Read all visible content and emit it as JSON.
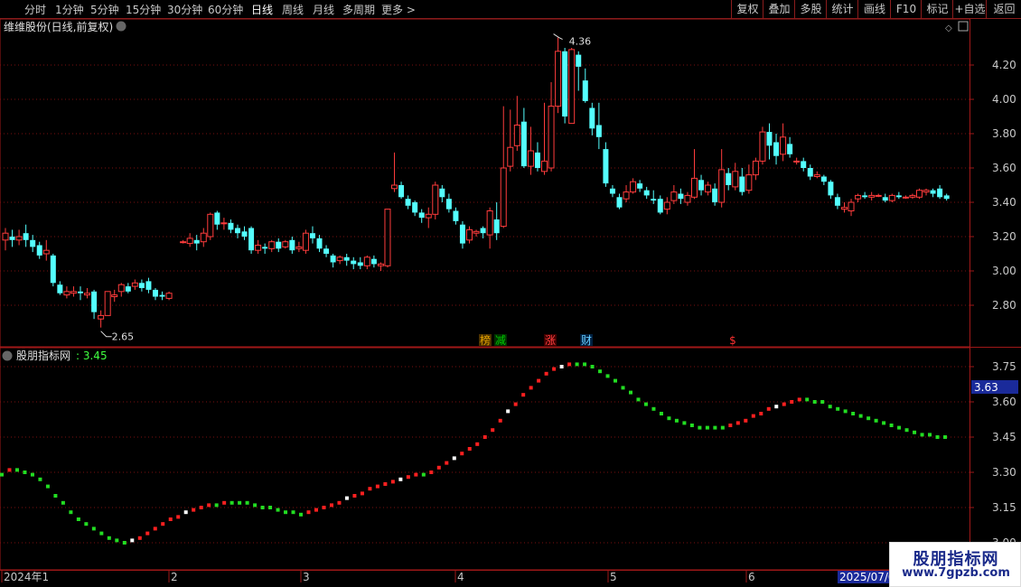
{
  "toolbar": {
    "periods": [
      "分时",
      "1分钟",
      "5分钟",
      "15分钟",
      "30分钟",
      "60分钟",
      "日线",
      "周线",
      "月线",
      "多周期",
      "更多 >"
    ],
    "active_period": "日线",
    "right_buttons": [
      "复权",
      "叠加",
      "多股",
      "统计",
      "画线",
      "F10",
      "标记",
      "+自选",
      "返回"
    ]
  },
  "main_panel": {
    "title": "维维股份(日线,前复权)",
    "high_label": "4.36",
    "low_label": "2.65",
    "event_marks": [
      {
        "text": "榜",
        "color": "#e0a000",
        "bg": "#4a3000"
      },
      {
        "text": "减",
        "color": "#00c800",
        "bg": "#003000"
      },
      {
        "text": "涨",
        "color": "#ff4040",
        "bg": "#400000"
      },
      {
        "text": "财",
        "color": "#66ccff",
        "bg": "#002040"
      },
      {
        "text": "$",
        "color": "#ff3030",
        "bg": ""
      }
    ],
    "y_ticks": [
      "4.20",
      "4.00",
      "3.80",
      "3.60",
      "3.40",
      "3.20",
      "3.00",
      "2.80"
    ]
  },
  "indicator_panel": {
    "name": "股朋指标网",
    "value": "3.45",
    "current_value_box": "3.63",
    "y_ticks": [
      "3.75",
      "3.60",
      "3.45",
      "3.30",
      "3.15",
      "3.00"
    ]
  },
  "x_axis": {
    "labels": [
      "2024年1",
      "2",
      "3",
      "4",
      "5",
      "6"
    ],
    "cursor_date": "2025/07/0"
  },
  "watermark": {
    "title": "股朋指标网",
    "url": "www.7gpzb.com"
  },
  "colors": {
    "up": "#ff3c3c",
    "down": "#54ffff",
    "indicator_up": "#ff2020",
    "indicator_down": "#22dd22",
    "indicator_flat": "#ffffff",
    "grid": "#7a1010",
    "frame": "#a01818"
  },
  "chart_data": [
    {
      "type": "candlestick",
      "title": "维维股份(日线,前复权)",
      "ylim": [
        2.62,
        4.38
      ],
      "candles": [
        [
          3.18,
          3.22,
          3.25,
          3.12
        ],
        [
          3.2,
          3.18,
          3.24,
          3.14
        ],
        [
          3.18,
          3.2,
          3.24,
          3.15
        ],
        [
          3.22,
          3.18,
          3.27,
          3.14
        ],
        [
          3.18,
          3.14,
          3.21,
          3.11
        ],
        [
          3.15,
          3.09,
          3.17,
          3.07
        ],
        [
          3.1,
          3.12,
          3.18,
          3.06
        ],
        [
          3.09,
          2.93,
          3.1,
          2.91
        ],
        [
          2.92,
          2.87,
          2.94,
          2.86
        ],
        [
          2.86,
          2.88,
          2.91,
          2.84
        ],
        [
          2.87,
          2.88,
          2.91,
          2.85
        ],
        [
          2.88,
          2.87,
          2.91,
          2.83
        ],
        [
          2.86,
          2.87,
          2.9,
          2.84
        ],
        [
          2.88,
          2.76,
          2.89,
          2.72
        ],
        [
          2.72,
          2.74,
          2.77,
          2.67
        ],
        [
          2.74,
          2.88,
          2.88,
          2.74
        ],
        [
          2.85,
          2.86,
          2.89,
          2.82
        ],
        [
          2.88,
          2.92,
          2.93,
          2.85
        ],
        [
          2.91,
          2.88,
          2.93,
          2.87
        ],
        [
          2.91,
          2.93,
          2.95,
          2.89
        ],
        [
          2.93,
          2.9,
          2.95,
          2.88
        ],
        [
          2.94,
          2.89,
          2.96,
          2.87
        ],
        [
          2.89,
          2.85,
          2.9,
          2.83
        ],
        [
          2.86,
          2.85,
          2.88,
          2.83
        ],
        [
          2.84,
          2.87,
          2.88,
          2.83
        ],
        [
          3.17,
          3.17,
          3.18,
          3.16
        ],
        [
          3.16,
          3.19,
          3.22,
          3.14
        ],
        [
          3.18,
          3.16,
          3.21,
          3.12
        ],
        [
          3.17,
          3.22,
          3.25,
          3.14
        ],
        [
          3.2,
          3.33,
          3.34,
          3.18
        ],
        [
          3.34,
          3.27,
          3.35,
          3.24
        ],
        [
          3.28,
          3.28,
          3.31,
          3.24
        ],
        [
          3.28,
          3.24,
          3.3,
          3.22
        ],
        [
          3.25,
          3.22,
          3.27,
          3.19
        ],
        [
          3.23,
          3.2,
          3.26,
          3.18
        ],
        [
          3.25,
          3.12,
          3.26,
          3.1
        ],
        [
          3.12,
          3.15,
          3.18,
          3.1
        ],
        [
          3.14,
          3.13,
          3.16,
          3.1
        ],
        [
          3.13,
          3.17,
          3.18,
          3.11
        ],
        [
          3.17,
          3.13,
          3.19,
          3.11
        ],
        [
          3.14,
          3.17,
          3.18,
          3.13
        ],
        [
          3.18,
          3.12,
          3.2,
          3.1
        ],
        [
          3.13,
          3.14,
          3.17,
          3.11
        ],
        [
          3.12,
          3.22,
          3.24,
          3.1
        ],
        [
          3.22,
          3.19,
          3.26,
          3.16
        ],
        [
          3.19,
          3.13,
          3.21,
          3.11
        ],
        [
          3.13,
          3.1,
          3.15,
          3.08
        ],
        [
          3.09,
          3.05,
          3.1,
          3.02
        ],
        [
          3.06,
          3.08,
          3.09,
          3.04
        ],
        [
          3.08,
          3.06,
          3.1,
          3.03
        ],
        [
          3.06,
          3.04,
          3.08,
          3.01
        ],
        [
          3.05,
          3.03,
          3.08,
          3.01
        ],
        [
          3.03,
          3.08,
          3.09,
          3.01
        ],
        [
          3.07,
          3.04,
          3.09,
          3.02
        ],
        [
          3.03,
          3.04,
          3.05,
          3.0
        ],
        [
          3.03,
          3.36,
          3.36,
          3.02
        ],
        [
          3.48,
          3.5,
          3.69,
          3.46
        ],
        [
          3.5,
          3.43,
          3.52,
          3.42
        ],
        [
          3.42,
          3.38,
          3.44,
          3.36
        ],
        [
          3.4,
          3.34,
          3.41,
          3.32
        ],
        [
          3.34,
          3.31,
          3.36,
          3.28
        ],
        [
          3.31,
          3.33,
          3.37,
          3.25
        ],
        [
          3.33,
          3.5,
          3.52,
          3.3
        ],
        [
          3.48,
          3.43,
          3.5,
          3.4
        ],
        [
          3.42,
          3.36,
          3.45,
          3.34
        ],
        [
          3.35,
          3.29,
          3.37,
          3.27
        ],
        [
          3.27,
          3.16,
          3.29,
          3.13
        ],
        [
          3.18,
          3.24,
          3.26,
          3.16
        ],
        [
          3.22,
          3.23,
          3.24,
          3.2
        ],
        [
          3.25,
          3.22,
          3.26,
          3.19
        ],
        [
          3.21,
          3.35,
          3.37,
          3.13
        ],
        [
          3.3,
          3.22,
          3.4,
          3.18
        ],
        [
          3.26,
          3.6,
          3.96,
          3.25
        ],
        [
          3.61,
          3.72,
          3.94,
          3.58
        ],
        [
          3.73,
          3.85,
          4.02,
          3.7
        ],
        [
          3.87,
          3.61,
          3.95,
          3.6
        ],
        [
          3.61,
          3.7,
          3.84,
          3.56
        ],
        [
          3.69,
          3.6,
          3.75,
          3.58
        ],
        [
          3.58,
          3.64,
          3.98,
          3.56
        ],
        [
          3.6,
          3.96,
          4.1,
          3.58
        ],
        [
          3.96,
          4.28,
          4.36,
          3.92
        ],
        [
          4.28,
          3.9,
          4.3,
          3.86
        ],
        [
          3.86,
          4.29,
          4.3,
          3.86
        ],
        [
          4.26,
          4.19,
          4.28,
          4.05
        ],
        [
          4.11,
          3.99,
          4.18,
          3.98
        ],
        [
          3.95,
          3.83,
          3.98,
          3.79
        ],
        [
          3.85,
          3.78,
          3.98,
          3.71
        ],
        [
          3.71,
          3.51,
          3.75,
          3.49
        ],
        [
          3.48,
          3.45,
          3.5,
          3.43
        ],
        [
          3.43,
          3.37,
          3.45,
          3.36
        ],
        [
          3.42,
          3.46,
          3.5,
          3.4
        ],
        [
          3.46,
          3.52,
          3.54,
          3.45
        ],
        [
          3.51,
          3.48,
          3.53,
          3.46
        ],
        [
          3.47,
          3.44,
          3.49,
          3.42
        ],
        [
          3.42,
          3.41,
          3.47,
          3.39
        ],
        [
          3.42,
          3.34,
          3.44,
          3.33
        ],
        [
          3.36,
          3.4,
          3.43,
          3.33
        ],
        [
          3.41,
          3.46,
          3.5,
          3.39
        ],
        [
          3.45,
          3.42,
          3.48,
          3.39
        ],
        [
          3.4,
          3.44,
          3.46,
          3.38
        ],
        [
          3.43,
          3.54,
          3.71,
          3.42
        ],
        [
          3.53,
          3.47,
          3.56,
          3.44
        ],
        [
          3.46,
          3.5,
          3.52,
          3.44
        ],
        [
          3.48,
          3.4,
          3.51,
          3.38
        ],
        [
          3.4,
          3.59,
          3.71,
          3.37
        ],
        [
          3.57,
          3.5,
          3.6,
          3.47
        ],
        [
          3.49,
          3.58,
          3.63,
          3.47
        ],
        [
          3.55,
          3.46,
          3.6,
          3.44
        ],
        [
          3.47,
          3.56,
          3.62,
          3.45
        ],
        [
          3.56,
          3.64,
          3.66,
          3.53
        ],
        [
          3.64,
          3.81,
          3.84,
          3.62
        ],
        [
          3.81,
          3.73,
          3.86,
          3.65
        ],
        [
          3.75,
          3.67,
          3.8,
          3.62
        ],
        [
          3.68,
          3.78,
          3.86,
          3.64
        ],
        [
          3.74,
          3.68,
          3.78,
          3.66
        ],
        [
          3.64,
          3.64,
          3.66,
          3.62
        ],
        [
          3.64,
          3.6,
          3.66,
          3.58
        ],
        [
          3.6,
          3.55,
          3.62,
          3.53
        ],
        [
          3.55,
          3.56,
          3.58,
          3.54
        ],
        [
          3.55,
          3.52,
          3.56,
          3.5
        ],
        [
          3.52,
          3.44,
          3.53,
          3.42
        ],
        [
          3.43,
          3.38,
          3.45,
          3.36
        ],
        [
          3.36,
          3.37,
          3.4,
          3.34
        ],
        [
          3.35,
          3.4,
          3.42,
          3.32
        ],
        [
          3.42,
          3.44,
          3.45,
          3.4
        ],
        [
          3.44,
          3.43,
          3.46,
          3.42
        ],
        [
          3.43,
          3.44,
          3.46,
          3.41
        ],
        [
          3.44,
          3.44,
          3.45,
          3.43
        ],
        [
          3.43,
          3.41,
          3.45,
          3.4
        ],
        [
          3.41,
          3.44,
          3.45,
          3.4
        ],
        [
          3.44,
          3.43,
          3.46,
          3.42
        ],
        [
          3.43,
          3.43,
          3.44,
          3.42
        ],
        [
          3.43,
          3.44,
          3.45,
          3.42
        ],
        [
          3.43,
          3.47,
          3.48,
          3.42
        ],
        [
          3.46,
          3.47,
          3.48,
          3.44
        ],
        [
          3.47,
          3.45,
          3.48,
          3.43
        ],
        [
          3.48,
          3.43,
          3.5,
          3.42
        ],
        [
          3.44,
          3.42,
          3.45,
          3.41
        ]
      ]
    },
    {
      "type": "line",
      "title": "股朋指标网",
      "ylim": [
        3.0,
        3.8
      ],
      "values": [
        3.29,
        3.31,
        3.31,
        3.3,
        3.29,
        3.27,
        3.24,
        3.2,
        3.17,
        3.13,
        3.1,
        3.08,
        3.06,
        3.04,
        3.02,
        3.01,
        3.0,
        3.01,
        3.02,
        3.04,
        3.06,
        3.08,
        3.1,
        3.11,
        3.13,
        3.14,
        3.15,
        3.16,
        3.16,
        3.17,
        3.17,
        3.17,
        3.17,
        3.16,
        3.15,
        3.15,
        3.14,
        3.13,
        3.13,
        3.12,
        3.13,
        3.14,
        3.15,
        3.16,
        3.17,
        3.19,
        3.2,
        3.21,
        3.23,
        3.24,
        3.25,
        3.26,
        3.27,
        3.28,
        3.29,
        3.29,
        3.3,
        3.32,
        3.34,
        3.36,
        3.38,
        3.4,
        3.42,
        3.45,
        3.48,
        3.52,
        3.56,
        3.59,
        3.63,
        3.66,
        3.69,
        3.72,
        3.74,
        3.75,
        3.76,
        3.76,
        3.76,
        3.75,
        3.73,
        3.71,
        3.69,
        3.66,
        3.64,
        3.61,
        3.59,
        3.57,
        3.55,
        3.53,
        3.52,
        3.51,
        3.5,
        3.49,
        3.49,
        3.49,
        3.49,
        3.5,
        3.51,
        3.52,
        3.54,
        3.55,
        3.57,
        3.58,
        3.59,
        3.6,
        3.61,
        3.61,
        3.6,
        3.6,
        3.58,
        3.57,
        3.56,
        3.55,
        3.54,
        3.53,
        3.52,
        3.51,
        3.5,
        3.49,
        3.48,
        3.47,
        3.46,
        3.46,
        3.45,
        3.45
      ]
    }
  ]
}
